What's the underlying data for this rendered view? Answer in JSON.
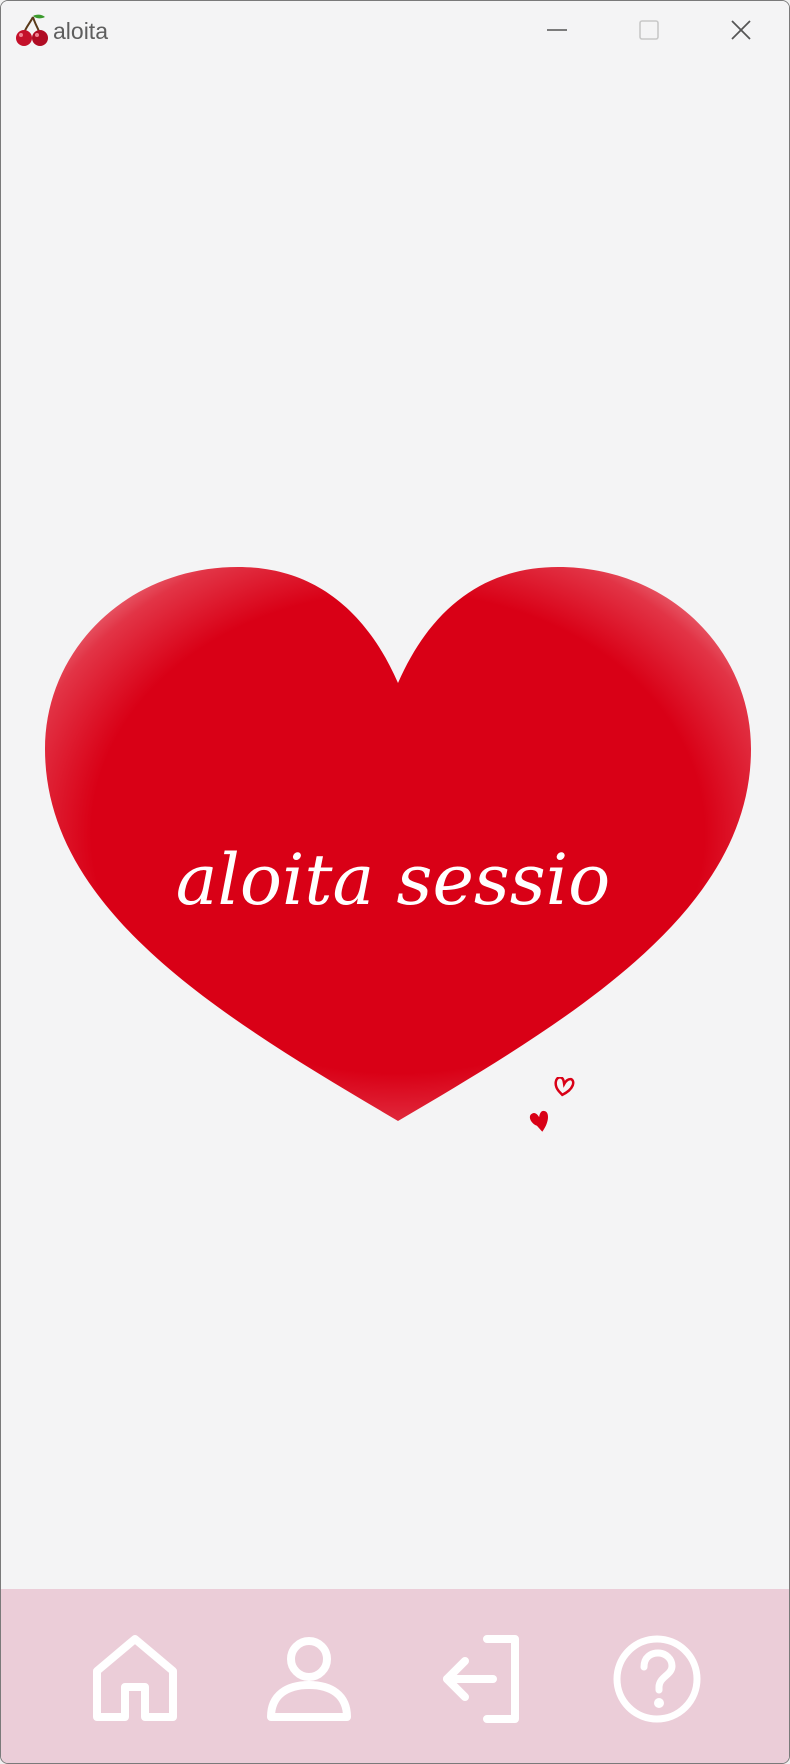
{
  "window": {
    "title": "aloita",
    "icon": "cherry-icon",
    "controls": [
      "minimize-icon",
      "maximize-icon",
      "close-icon"
    ]
  },
  "main": {
    "heart_text": "aloita sessio",
    "heart_color": "#d90016",
    "decoration": "small-hearts-icon"
  },
  "bottom_nav": {
    "background": "#ebcdd8",
    "items": [
      {
        "icon": "home-icon"
      },
      {
        "icon": "user-icon"
      },
      {
        "icon": "logout-icon"
      },
      {
        "icon": "help-icon"
      }
    ]
  }
}
